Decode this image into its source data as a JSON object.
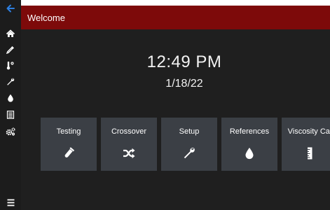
{
  "header": {
    "title": "Welcome"
  },
  "main": {
    "time": "12:49 PM",
    "date": "1/18/22"
  },
  "tiles": [
    {
      "label": "Testing",
      "icon": "flask-icon"
    },
    {
      "label": "Crossover",
      "icon": "shuffle-icon"
    },
    {
      "label": "Setup",
      "icon": "wrench-icon"
    },
    {
      "label": "References",
      "icon": "droplet-icon"
    },
    {
      "label": "Viscosity Cal",
      "icon": "ruler-icon"
    }
  ],
  "sidebar": {
    "items": [
      {
        "icon": "back-arrow-icon"
      },
      {
        "icon": "home-icon"
      },
      {
        "icon": "pipette-icon"
      },
      {
        "icon": "thermometer-icon"
      },
      {
        "icon": "wrench-icon"
      },
      {
        "icon": "droplet-icon"
      },
      {
        "icon": "list-icon"
      },
      {
        "icon": "gears-icon"
      },
      {
        "icon": "menu-icon"
      }
    ]
  },
  "colors": {
    "header": "#7d0a0a",
    "sidebar": "#1c1c1c",
    "main_background": "#1f1f1f",
    "tile": "#3b3f45",
    "accent": "#2d7fe0"
  }
}
